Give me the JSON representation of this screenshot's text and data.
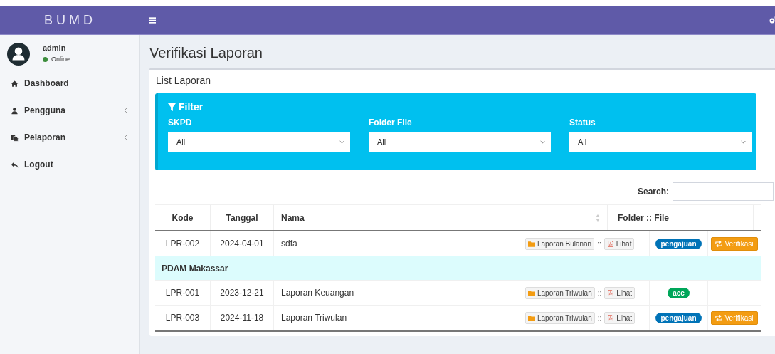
{
  "brand": "BUMD",
  "user": {
    "name": "admin",
    "status": "Online"
  },
  "sidebar": {
    "items": [
      {
        "label": "Dashboard",
        "kind": "home",
        "expandable": false
      },
      {
        "label": "Pengguna",
        "kind": "user",
        "expandable": true
      },
      {
        "label": "Pelaporan",
        "kind": "files",
        "expandable": true
      },
      {
        "label": "Logout",
        "kind": "reply",
        "expandable": false
      }
    ]
  },
  "page_title": "Verifikasi Laporan",
  "card_title": "List Laporan",
  "filter": {
    "title": "Filter",
    "fields": [
      {
        "label": "SKPD",
        "value": "All"
      },
      {
        "label": "Folder File",
        "value": "All"
      },
      {
        "label": "Status",
        "value": "All"
      }
    ]
  },
  "search": {
    "label": "Search:"
  },
  "table": {
    "columns": [
      "Kode",
      "Tanggal",
      "Nama",
      "Folder :: File"
    ],
    "rows": [
      {
        "kind": "data",
        "kode": "LPR-002",
        "tanggal": "2024-04-01",
        "nama": "sdfa",
        "folder": "Laporan Bulanan",
        "separator": "::",
        "file": "Lihat",
        "status": {
          "label": "pengajuan",
          "color": "#0073b7"
        },
        "action": "Verifikasi"
      },
      {
        "kind": "group",
        "label": "PDAM Makassar"
      },
      {
        "kind": "data",
        "kode": "LPR-001",
        "tanggal": "2023-12-21",
        "nama": "Laporan Keuangan",
        "folder": "Laporan Triwulan",
        "separator": "::",
        "file": "Lihat",
        "status": {
          "label": "acc",
          "color": "#00a65a"
        }
      },
      {
        "kind": "data",
        "kode": "LPR-003",
        "tanggal": "2024-11-18",
        "nama": "Laporan Triwulan",
        "folder": "Laporan Triwulan",
        "separator": "::",
        "file": "Lihat",
        "status": {
          "label": "pengajuan",
          "color": "#0073b7"
        },
        "action": "Verifikasi"
      }
    ]
  }
}
